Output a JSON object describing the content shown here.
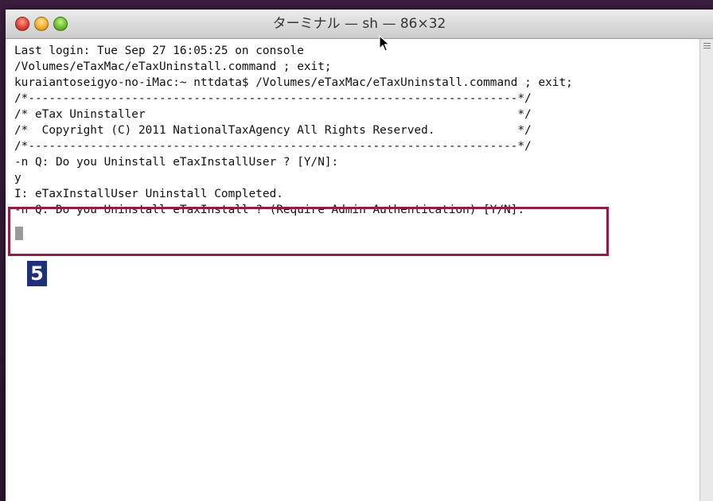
{
  "window": {
    "title": "ターミナル — sh — 86×32"
  },
  "terminal": {
    "lines": [
      "Last login: Tue Sep 27 16:05:25 on console",
      "/Volumes/eTaxMac/eTaxUninstall.command ; exit;",
      "kuraiantoseigyo-no-iMac:~ nttdata$ /Volumes/eTaxMac/eTaxUninstall.command ; exit;",
      "/*-----------------------------------------------------------------------*/",
      "/* eTax Uninstaller                                                      */",
      "/*  Copyright (C) 2011 NationalTaxAgency All Rights Reserved.            */",
      "/*-----------------------------------------------------------------------*/",
      "-n Q: Do you Uninstall eTaxInstallUser ? [Y/N]:",
      "y",
      "I: eTaxInstallUser Uninstall Completed.",
      "-n Q: Do you Uninstall eTaxInstall ? (Require Admin Authentication) [Y/N]:"
    ]
  },
  "annotation": {
    "step_number": "5",
    "box_color": "#8e1d47",
    "badge_color": "#1f2f7a"
  }
}
